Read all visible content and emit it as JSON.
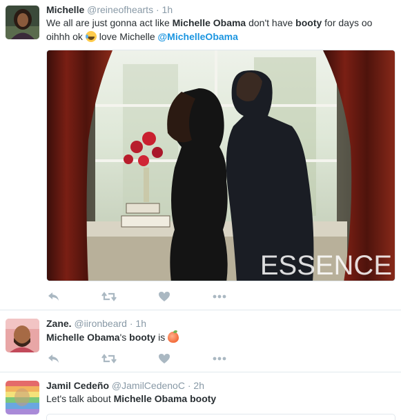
{
  "tweets": [
    {
      "fullname": "Michelle",
      "username": "@reineofhearts",
      "separator": "·",
      "time": "1h",
      "text_parts": {
        "p1": "We all are just gonna act like ",
        "b1": "Michelle Obama",
        "p2": " don't have  ",
        "b2": "booty",
        "p3": " for days oo oihhh ok ",
        "p4": " love Michelle ",
        "mention": "@MichelleObama"
      },
      "emoji": "face-with-tears-of-joy",
      "image_watermark": "ESSENCE"
    },
    {
      "fullname": "Zane.",
      "username": "@iironbeard",
      "separator": "·",
      "time": "1h",
      "text_parts": {
        "b1": "Michelle Obama",
        "p1": "'s ",
        "b2": "booty",
        "p2": " is "
      },
      "emoji": "peach"
    },
    {
      "fullname": "Jamil Cedeño",
      "username": "@JamilCedenoC",
      "separator": "·",
      "time": "2h",
      "text_parts": {
        "p1": "Let's talk about ",
        "b1": "Michelle Obama booty"
      }
    }
  ],
  "colors": {
    "link": "#1b95e0",
    "secondary_text": "#8899a6",
    "primary_text": "#292f33",
    "action_icon": "#aab8c2",
    "divider": "#e1e8ed"
  },
  "icons": [
    "reply-icon",
    "retweet-icon",
    "like-icon",
    "more-icon"
  ]
}
